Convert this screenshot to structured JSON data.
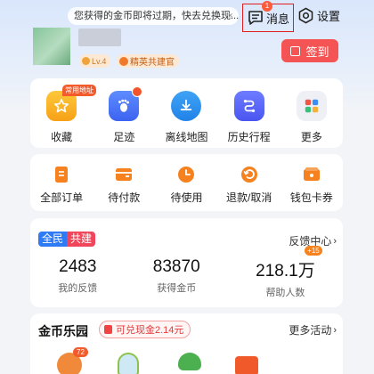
{
  "notice": {
    "text": "您获得的金币即将过期，快去兑换现...",
    "close": "×"
  },
  "header": {
    "messages_label": "消息",
    "messages_badge": "1",
    "settings_label": "设置"
  },
  "user": {
    "level": "Lv.4",
    "title_badge": "精英共建官"
  },
  "signin": {
    "label": "签到"
  },
  "quick_tools": [
    {
      "label": "收藏",
      "icon": "star-icon",
      "tag": "常用地址"
    },
    {
      "label": "足迹",
      "icon": "footprint-icon"
    },
    {
      "label": "离线地图",
      "icon": "download-icon"
    },
    {
      "label": "历史行程",
      "icon": "route-icon"
    },
    {
      "label": "更多",
      "icon": "grid-icon"
    }
  ],
  "orders": [
    {
      "label": "全部订单",
      "icon": "order-list-icon"
    },
    {
      "label": "待付款",
      "icon": "wallet-icon"
    },
    {
      "label": "待使用",
      "icon": "clock-icon"
    },
    {
      "label": "退款/取消",
      "icon": "refund-icon"
    },
    {
      "label": "钱包卡券",
      "icon": "coupon-icon"
    }
  ],
  "community": {
    "badge_left": "全民",
    "badge_right": "共建",
    "link": "反馈中心",
    "stats": [
      {
        "value": "2483",
        "label": "我的反馈"
      },
      {
        "value": "83870",
        "label": "获得金币"
      },
      {
        "value": "218.1万",
        "label": "帮助人数",
        "increment": "+15"
      }
    ]
  },
  "coin_park": {
    "title": "金币乐园",
    "cash_label": "可兑现金2.14元",
    "more": "更多活动",
    "item_badge": "72"
  },
  "colors": {
    "accent": "#f45454",
    "brand_blue": "#2f7bf6",
    "orange": "#f5821f"
  }
}
